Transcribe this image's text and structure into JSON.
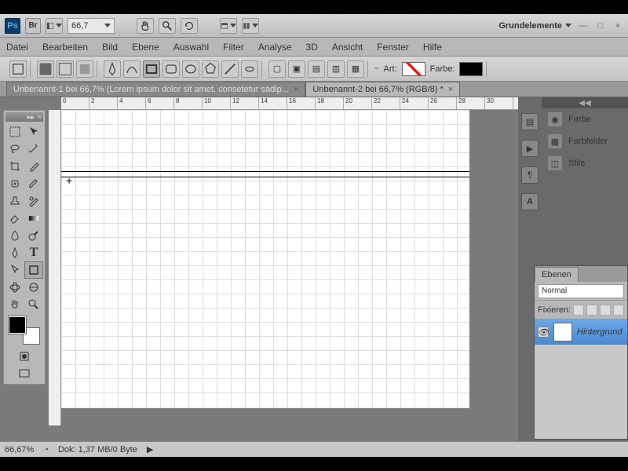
{
  "topbar": {
    "zoom": "66,7",
    "workspace": "Grundelemente"
  },
  "menu": [
    "Datei",
    "Bearbeiten",
    "Bild",
    "Ebene",
    "Auswahl",
    "Filter",
    "Analyse",
    "3D",
    "Ansicht",
    "Fenster",
    "Hilfe"
  ],
  "optbar": {
    "art_label": "Art:",
    "farbe_label": "Farbe:",
    "farbe_color": "#000000",
    "art_color": "#ff0000"
  },
  "tabs": [
    {
      "title": "Unbenannt-1 bei 66,7% (Lorem ipsum dolor sit amet, consetetur sadip...",
      "active": false
    },
    {
      "title": "Unbenannt-2 bei 66,7% (RGB/8) *",
      "active": true
    }
  ],
  "ruler_marks": [
    "0",
    "2",
    "4",
    "6",
    "8",
    "10",
    "12",
    "14",
    "16",
    "18",
    "20",
    "22",
    "24",
    "26",
    "28",
    "30"
  ],
  "status": {
    "zoom": "66,67%",
    "doc": "Dok: 1,37 MB/0 Byte"
  },
  "right_panels": {
    "items": [
      "Farbe",
      "Farbfelder",
      "Stile"
    ]
  },
  "layers": {
    "tab": "Ebenen",
    "blend": "Normal",
    "lock_label": "Fixieren:",
    "layer_name": "Hintergrund"
  },
  "colors": {
    "fg": "#000000",
    "bg": "#ffffff"
  }
}
